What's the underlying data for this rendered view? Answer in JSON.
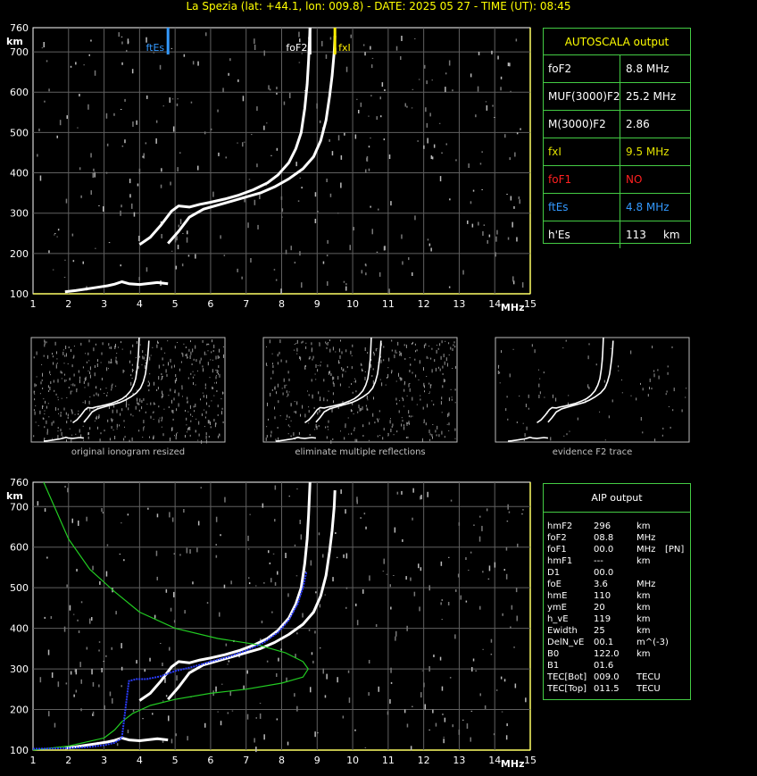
{
  "header": {
    "title": "La Spezia (lat: +44.1, lon: 009.8) - DATE: 2025 05 27 - TIME (UT): 08:45"
  },
  "autoscala": {
    "title": "AUTOSCALA output",
    "rows": [
      {
        "key": "foF2",
        "value": "8.8 MHz",
        "key_color": "#ffffff",
        "value_color": "#ffffff"
      },
      {
        "key": "MUF(3000)F2",
        "value": "25.2 MHz",
        "key_color": "#ffffff",
        "value_color": "#ffffff"
      },
      {
        "key": "M(3000)F2",
        "value": "2.86",
        "key_color": "#ffffff",
        "value_color": "#ffffff"
      },
      {
        "key": "fxI",
        "value": "9.5 MHz",
        "key_color": "#e0e000",
        "value_color": "#e0e000"
      },
      {
        "key": "foF1",
        "value": "NO",
        "key_color": "#ff2020",
        "value_color": "#ff2020"
      },
      {
        "key": "ftEs",
        "value": "4.8 MHz",
        "key_color": "#3399ff",
        "value_color": "#3399ff"
      },
      {
        "key": "h'Es",
        "value": "113     km",
        "key_color": "#ffffff",
        "value_color": "#ffffff"
      }
    ]
  },
  "aip": {
    "title": "AIP output",
    "rows": [
      {
        "k": "hmF2",
        "v": "296",
        "u": "km",
        "x": ""
      },
      {
        "k": "foF2",
        "v": "08.8",
        "u": "MHz",
        "x": ""
      },
      {
        "k": "foF1",
        "v": "00.0",
        "u": "MHz",
        "x": "[PN]"
      },
      {
        "k": "hmF1",
        "v": "---",
        "u": "km",
        "x": ""
      },
      {
        "k": "D1",
        "v": "00.0",
        "u": "",
        "x": ""
      },
      {
        "k": "foE",
        "v": "3.6",
        "u": "MHz",
        "x": ""
      },
      {
        "k": "hmE",
        "v": "110",
        "u": "km",
        "x": ""
      },
      {
        "k": "ymE",
        "v": "20",
        "u": "km",
        "x": ""
      },
      {
        "k": "h_vE",
        "v": "119",
        "u": "km",
        "x": ""
      },
      {
        "k": "Ewidth",
        "v": "25",
        "u": "km",
        "x": ""
      },
      {
        "k": "DelN_vE",
        "v": "00.1",
        "u": "m^(-3)",
        "x": ""
      },
      {
        "k": "B0",
        "v": "122.0",
        "u": "km",
        "x": ""
      },
      {
        "k": "B1",
        "v": "01.6",
        "u": "",
        "x": ""
      },
      {
        "k": "TEC[Bot]",
        "v": "009.0",
        "u": "TECU",
        "x": ""
      },
      {
        "k": "TEC[Top]",
        "v": "011.5",
        "u": "TECU",
        "x": ""
      }
    ]
  },
  "thumbnails": [
    {
      "caption": "original ionogram resized"
    },
    {
      "caption": "eliminate multiple reflections"
    },
    {
      "caption": "evidence F2 trace"
    }
  ],
  "chart_data": [
    {
      "type": "scatter",
      "name": "top-ionogram",
      "xlim": [
        1,
        15
      ],
      "ylim": [
        100,
        760
      ],
      "x_ticks": [
        1,
        2,
        3,
        4,
        5,
        6,
        7,
        8,
        9,
        10,
        11,
        12,
        13,
        14,
        15
      ],
      "y_ticks": [
        100,
        200,
        300,
        400,
        500,
        600,
        700
      ],
      "y_top_label": "760",
      "x_unit": "MHz",
      "y_unit": "km",
      "markers": [
        {
          "label": "ftEs",
          "x": 4.8,
          "color": "#3399ff"
        },
        {
          "label": "foF2",
          "x": 8.8,
          "color": "#ffffff"
        },
        {
          "label": "fxI",
          "x": 9.5,
          "color": "#ffee00"
        }
      ],
      "traces": [
        {
          "name": "o-trace",
          "x": [
            4.0,
            4.3,
            4.6,
            4.9,
            5.1,
            5.4,
            5.7,
            6.0,
            6.4,
            6.8,
            7.2,
            7.6,
            7.9,
            8.2,
            8.4,
            8.55,
            8.65,
            8.72,
            8.76,
            8.78,
            8.8
          ],
          "y": [
            222,
            240,
            270,
            305,
            318,
            315,
            322,
            327,
            335,
            345,
            358,
            375,
            395,
            425,
            460,
            500,
            560,
            620,
            680,
            720,
            760
          ]
        },
        {
          "name": "x-trace",
          "x": [
            4.8,
            5.1,
            5.4,
            5.8,
            6.2,
            6.6,
            7.0,
            7.4,
            7.8,
            8.2,
            8.6,
            8.9,
            9.1,
            9.25,
            9.35,
            9.42,
            9.48,
            9.5
          ],
          "y": [
            225,
            255,
            290,
            310,
            320,
            330,
            340,
            350,
            365,
            385,
            410,
            440,
            480,
            530,
            590,
            640,
            700,
            740
          ]
        },
        {
          "name": "E-trace",
          "x": [
            1.9,
            2.2,
            2.5,
            2.8,
            3.1,
            3.3,
            3.5,
            3.7,
            4.0,
            4.5,
            4.8
          ],
          "y": [
            105,
            108,
            112,
            116,
            120,
            124,
            130,
            125,
            123,
            128,
            125
          ]
        }
      ]
    },
    {
      "type": "scatter",
      "name": "bottom-ionogram",
      "xlim": [
        1,
        15
      ],
      "ylim": [
        100,
        760
      ],
      "x_ticks": [
        1,
        2,
        3,
        4,
        5,
        6,
        7,
        8,
        9,
        10,
        11,
        12,
        13,
        14,
        15
      ],
      "y_ticks": [
        100,
        200,
        300,
        400,
        500,
        600,
        700
      ],
      "y_top_label": "760",
      "x_unit": "MHz",
      "y_unit": "km",
      "profile": {
        "name": "electron-density-profile",
        "x": [
          1.3,
          1.6,
          2.0,
          2.6,
          3.3,
          4.0,
          5.0,
          6.2,
          7.3,
          8.1,
          8.6,
          8.75,
          8.6,
          8.0,
          7.0,
          6.0,
          5.0,
          4.3,
          3.8,
          3.5,
          3.3,
          3.0,
          2.5,
          2.0,
          1.5,
          1.0
        ],
        "y": [
          760,
          700,
          620,
          545,
          490,
          440,
          400,
          375,
          360,
          340,
          318,
          300,
          280,
          265,
          250,
          240,
          225,
          210,
          190,
          170,
          150,
          130,
          120,
          110,
          105,
          100
        ]
      },
      "aip_trace": {
        "name": "aip-virtual-height",
        "x": [
          1.0,
          1.5,
          2.0,
          2.5,
          3.0,
          3.3,
          3.5,
          3.7,
          3.9,
          4.2,
          4.6,
          5.0,
          5.5,
          6.0,
          6.5,
          7.0,
          7.5,
          7.9,
          8.2,
          8.45,
          8.6,
          8.7
        ],
        "y": [
          103,
          104,
          105,
          107,
          112,
          118,
          130,
          270,
          275,
          275,
          282,
          295,
          305,
          318,
          330,
          345,
          365,
          390,
          420,
          460,
          500,
          540
        ]
      }
    }
  ]
}
